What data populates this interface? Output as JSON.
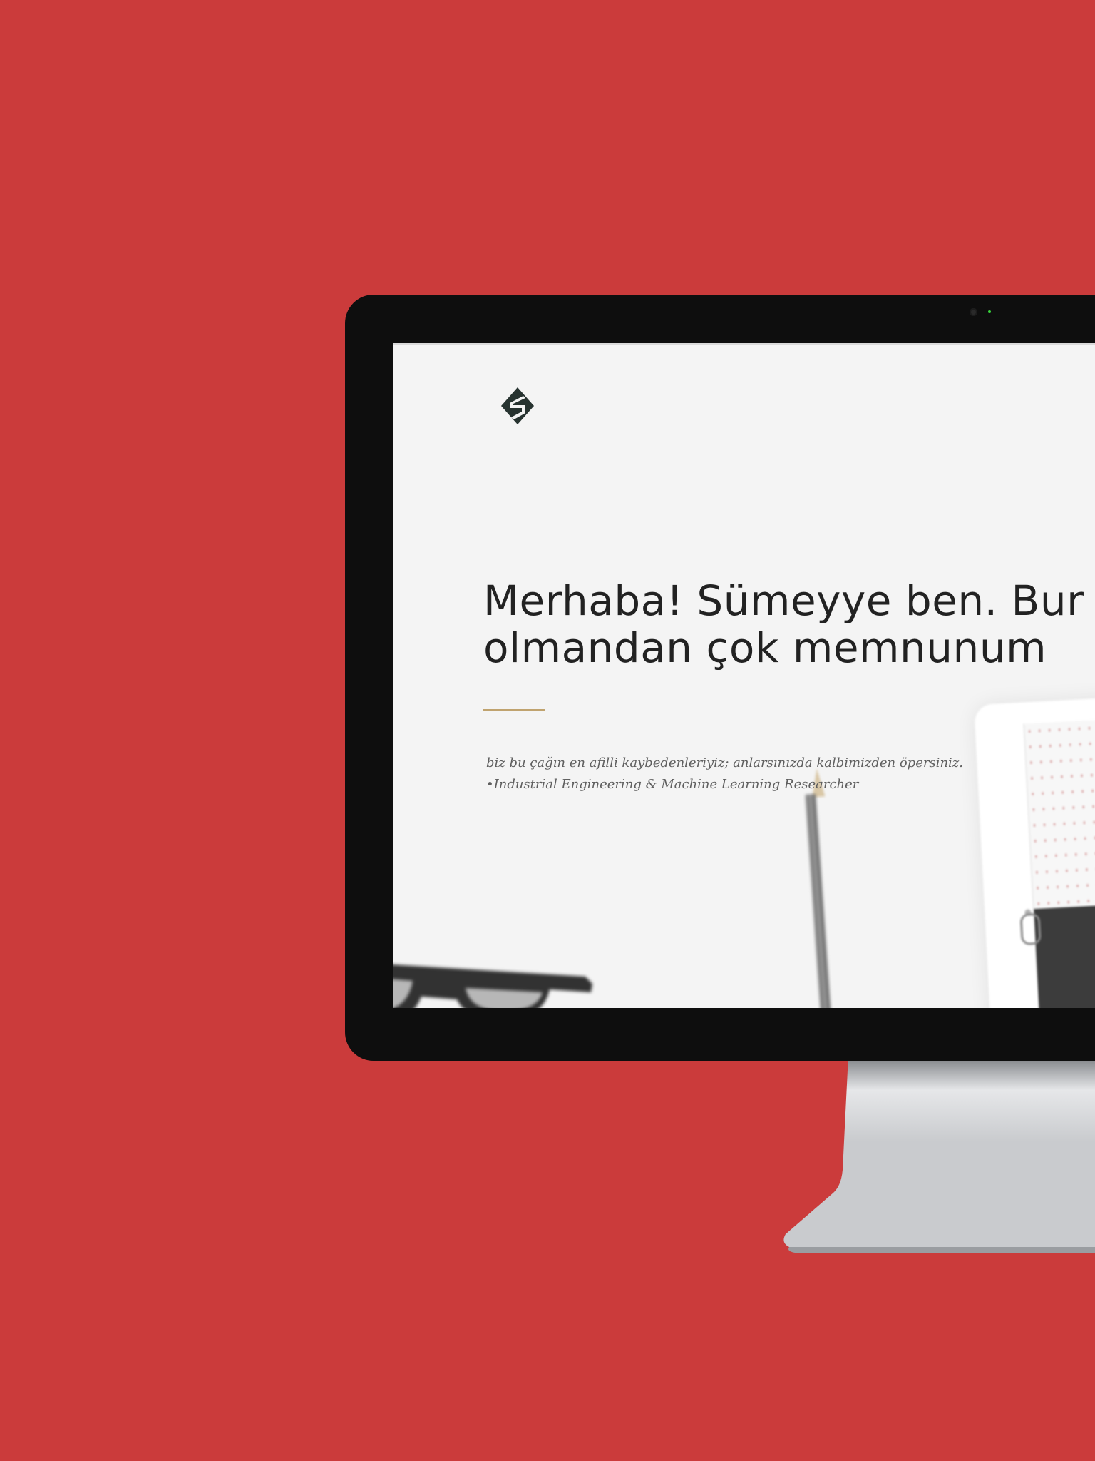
{
  "page": {
    "background_color": "#cb3b3b",
    "accent_color": "#c0a36f"
  },
  "header": {
    "logo_icon": "sumeyye-monogram-logo"
  },
  "hero": {
    "headline_lines": [
      "Merhaba! Sümeyye ben. Bur",
      "olmandan çok memnunum"
    ],
    "tagline_lines": [
      "biz bu çağın en afilli kaybedenleriyiz; anlarsınızda kalbimizden öpersiniz.",
      "•Industrial Engineering & Machine Learning Researcher"
    ]
  }
}
